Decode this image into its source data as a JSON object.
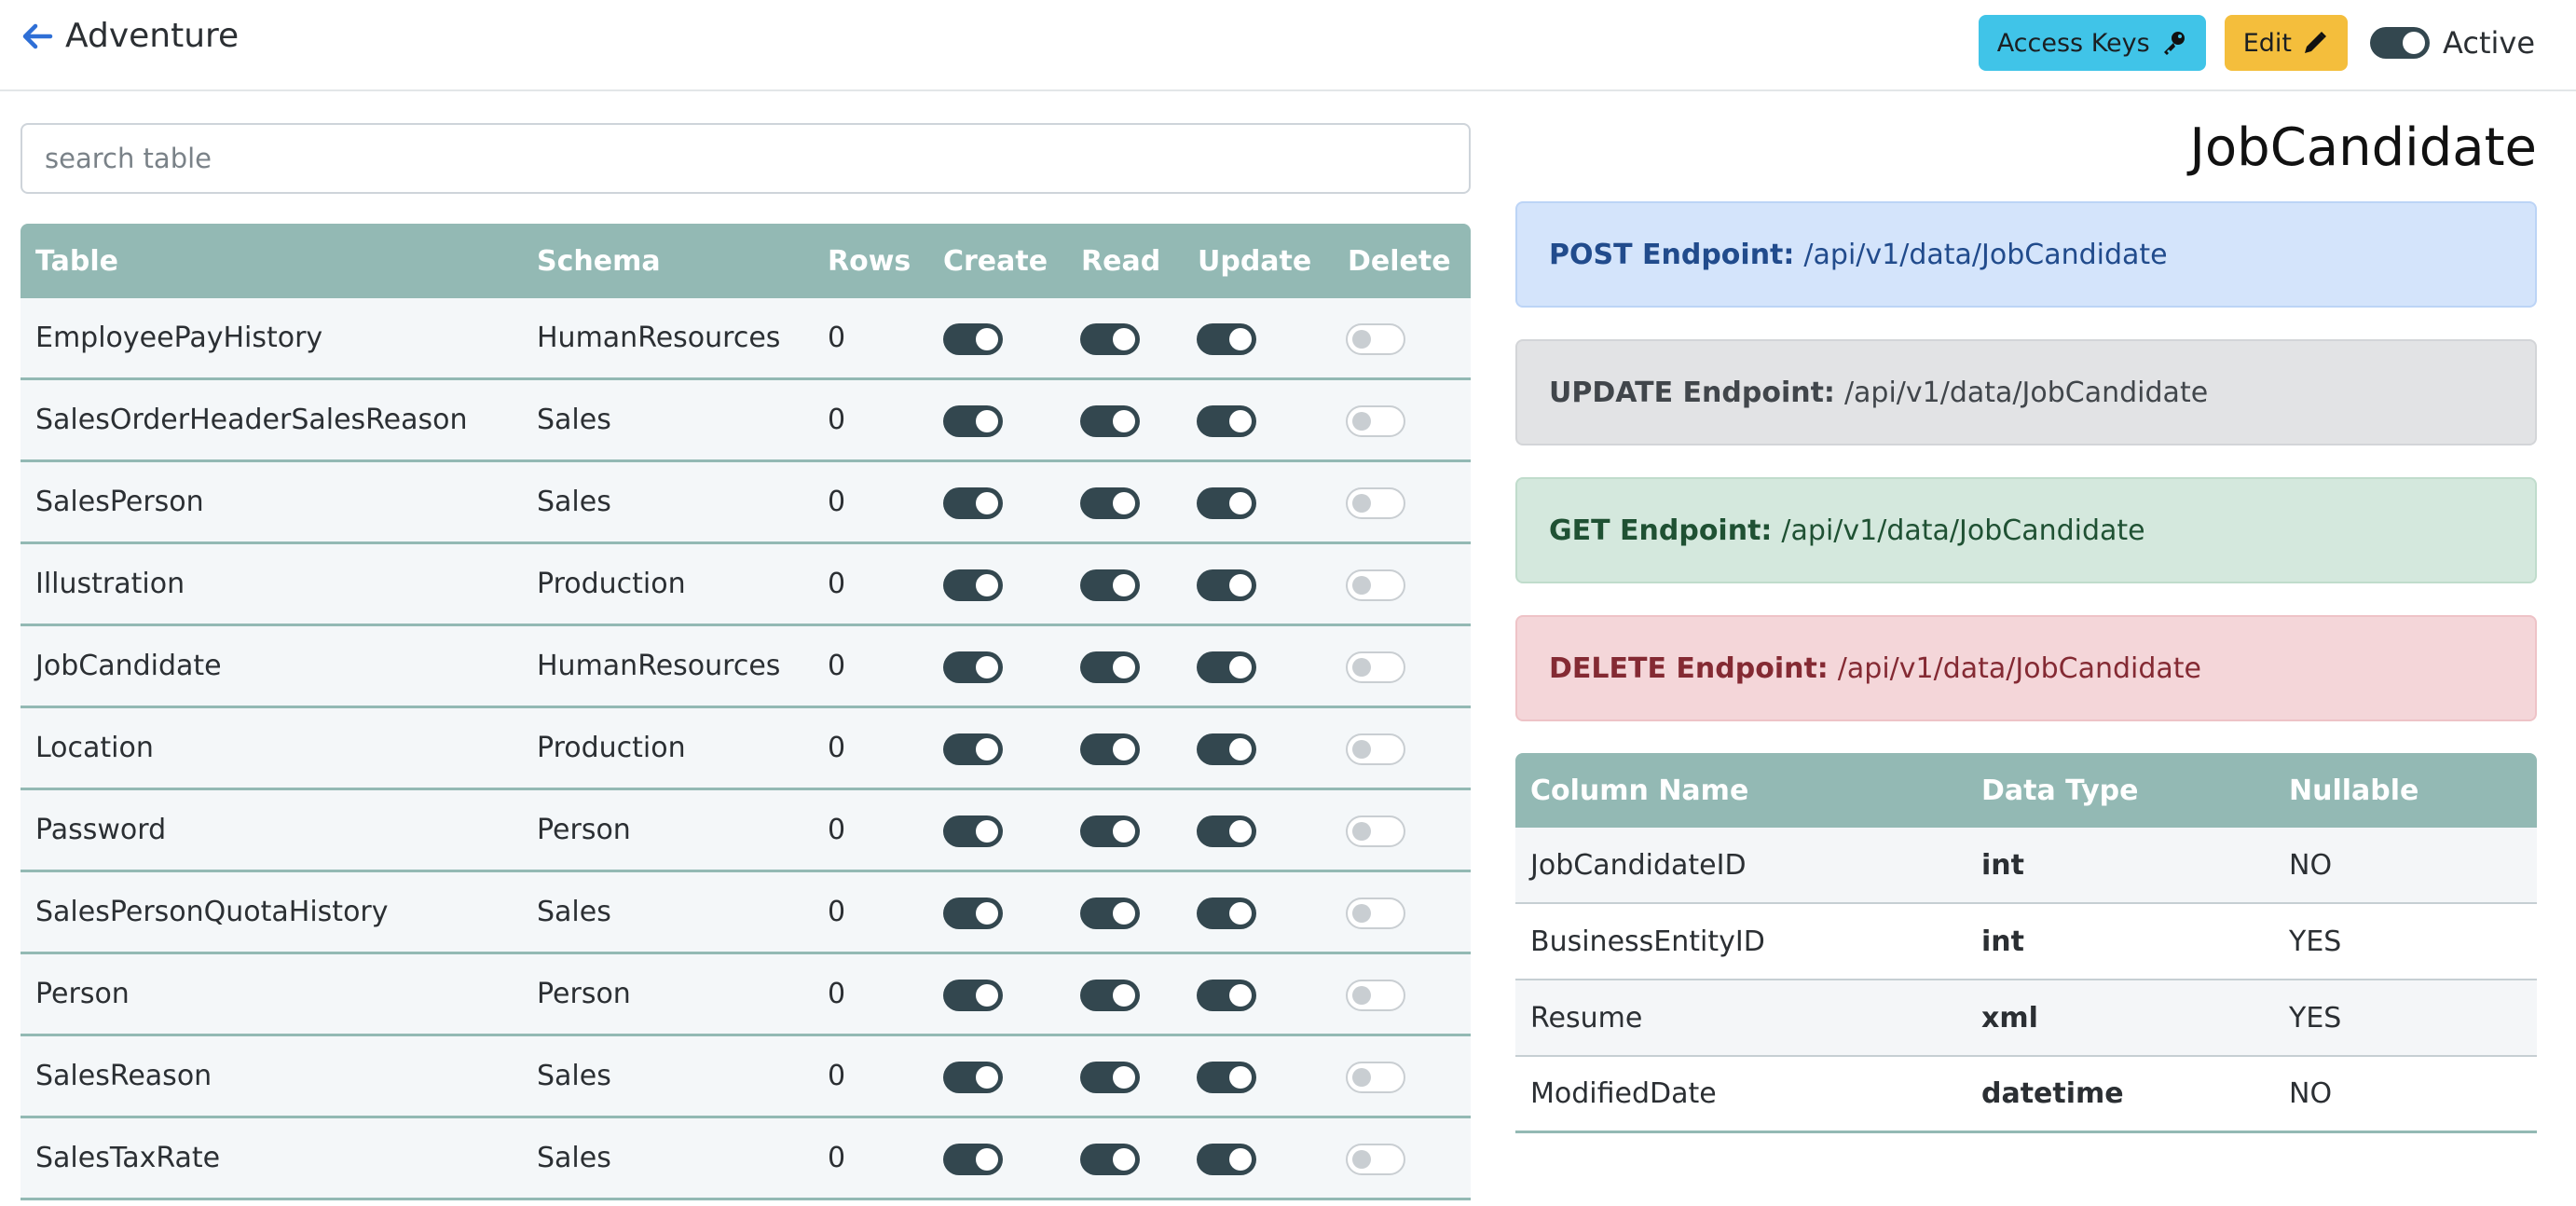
{
  "header": {
    "title": "Adventure",
    "access_keys_label": "Access Keys",
    "edit_label": "Edit",
    "active_label": "Active",
    "active": true
  },
  "search": {
    "placeholder": "search table",
    "value": ""
  },
  "tables": {
    "columns": [
      "Table",
      "Schema",
      "Rows",
      "Create",
      "Read",
      "Update",
      "Delete"
    ],
    "rows": [
      {
        "name": "EmployeePayHistory",
        "schema": "HumanResources",
        "rows": "0",
        "create": true,
        "read": true,
        "update": true,
        "delete": false
      },
      {
        "name": "SalesOrderHeaderSalesReason",
        "schema": "Sales",
        "rows": "0",
        "create": true,
        "read": true,
        "update": true,
        "delete": false
      },
      {
        "name": "SalesPerson",
        "schema": "Sales",
        "rows": "0",
        "create": true,
        "read": true,
        "update": true,
        "delete": false
      },
      {
        "name": "Illustration",
        "schema": "Production",
        "rows": "0",
        "create": true,
        "read": true,
        "update": true,
        "delete": false
      },
      {
        "name": "JobCandidate",
        "schema": "HumanResources",
        "rows": "0",
        "create": true,
        "read": true,
        "update": true,
        "delete": false
      },
      {
        "name": "Location",
        "schema": "Production",
        "rows": "0",
        "create": true,
        "read": true,
        "update": true,
        "delete": false
      },
      {
        "name": "Password",
        "schema": "Person",
        "rows": "0",
        "create": true,
        "read": true,
        "update": true,
        "delete": false
      },
      {
        "name": "SalesPersonQuotaHistory",
        "schema": "Sales",
        "rows": "0",
        "create": true,
        "read": true,
        "update": true,
        "delete": false
      },
      {
        "name": "Person",
        "schema": "Person",
        "rows": "0",
        "create": true,
        "read": true,
        "update": true,
        "delete": false
      },
      {
        "name": "SalesReason",
        "schema": "Sales",
        "rows": "0",
        "create": true,
        "read": true,
        "update": true,
        "delete": false
      },
      {
        "name": "SalesTaxRate",
        "schema": "Sales",
        "rows": "0",
        "create": true,
        "read": true,
        "update": true,
        "delete": false
      }
    ]
  },
  "detail": {
    "title": "JobCandidate",
    "endpoints": {
      "post": {
        "label": "POST Endpoint:",
        "path": "/api/v1/data/JobCandidate"
      },
      "update": {
        "label": "UPDATE Endpoint:",
        "path": "/api/v1/data/JobCandidate"
      },
      "get": {
        "label": "GET Endpoint:",
        "path": "/api/v1/data/JobCandidate"
      },
      "delete": {
        "label": "DELETE Endpoint:",
        "path": "/api/v1/data/JobCandidate"
      }
    },
    "columns_table": {
      "headers": [
        "Column Name",
        "Data Type",
        "Nullable"
      ],
      "rows": [
        {
          "name": "JobCandidateID",
          "type": "int",
          "nullable": "NO"
        },
        {
          "name": "BusinessEntityID",
          "type": "int",
          "nullable": "YES"
        },
        {
          "name": "Resume",
          "type": "xml",
          "nullable": "YES"
        },
        {
          "name": "ModifiedDate",
          "type": "datetime",
          "nullable": "NO"
        }
      ]
    }
  },
  "colors": {
    "table_header": "#93b9b4",
    "toggle_on": "#33474f",
    "access_keys_button": "#40c4e8",
    "edit_button": "#f4be3c",
    "post_bg": "#d4e4fb",
    "update_bg": "#e2e3e5",
    "get_bg": "#d4e8dd",
    "delete_bg": "#f4d6d9"
  }
}
